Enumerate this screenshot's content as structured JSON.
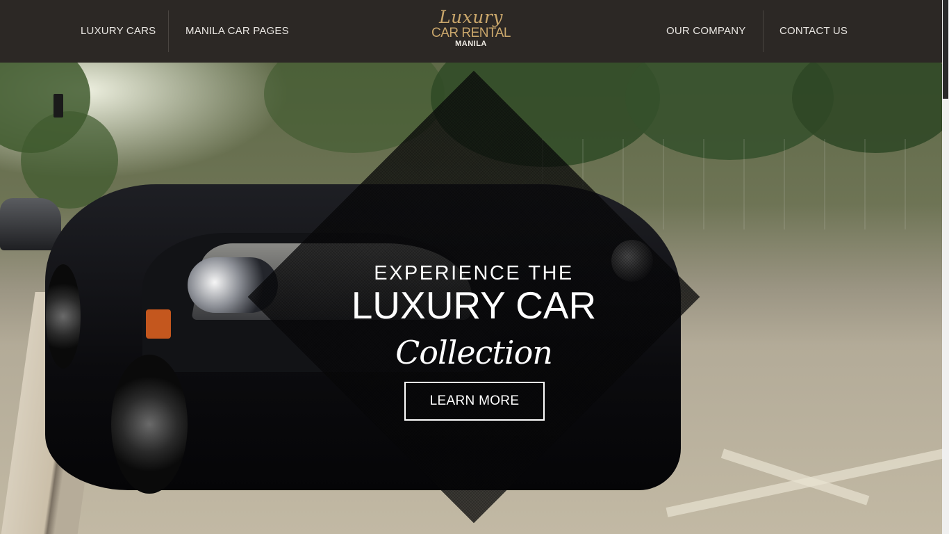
{
  "header": {
    "nav_left": [
      {
        "label": "LUXURY CARS"
      },
      {
        "label": "MANILA CAR PAGES"
      }
    ],
    "nav_right": [
      {
        "label": "OUR COMPANY"
      },
      {
        "label": "CONTACT US"
      }
    ],
    "logo": {
      "script": "Luxury",
      "main": "CAR RENTAL",
      "sub": "MANILA"
    }
  },
  "hero": {
    "line1": "EXPERIENCE THE",
    "line2": "LUXURY CAR",
    "line3": "Collection",
    "button_label": "LEARN MORE"
  },
  "colors": {
    "header_bg": "#2c2825",
    "logo_gold": "#c9a66b",
    "nav_text": "#e9e6e2"
  }
}
